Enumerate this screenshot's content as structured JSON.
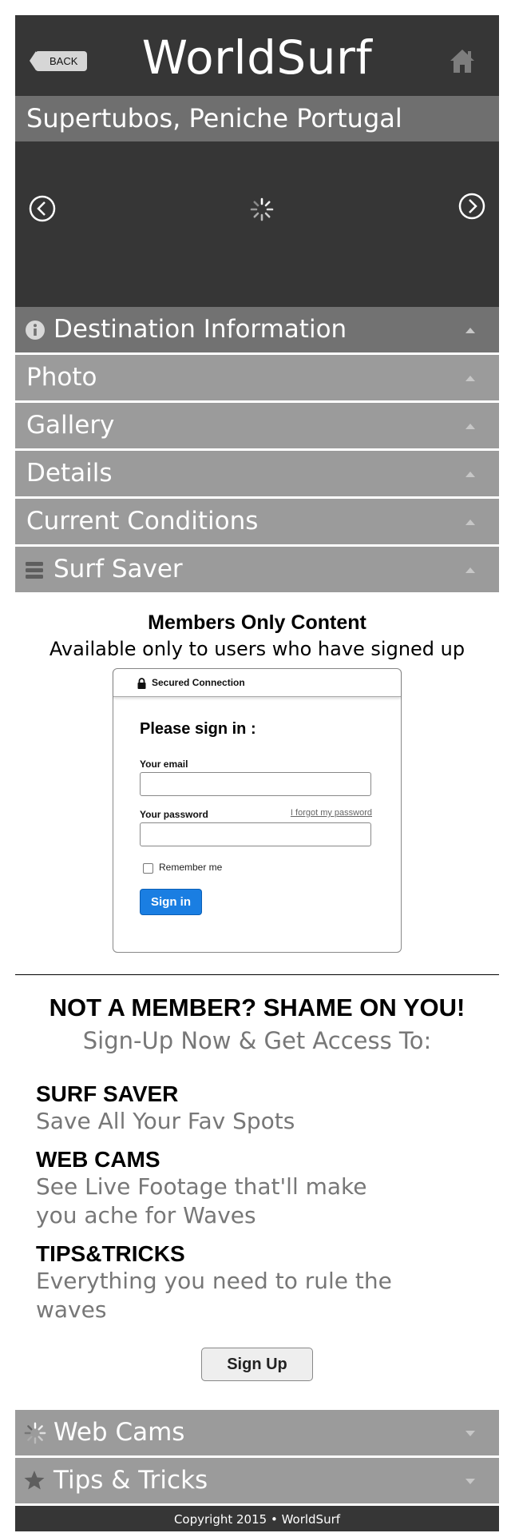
{
  "header": {
    "back_label": "BACK",
    "app_title": "WorldSurf",
    "home_icon": "home-icon"
  },
  "location": "Supertubos, Peniche Portugal",
  "slideshow": {
    "prev_icon": "chevron-left-icon",
    "next_icon": "chevron-right-icon",
    "loading_icon": "spinner-icon"
  },
  "accordion": [
    {
      "label": "Destination Information",
      "icon": "info-icon",
      "state": "expanded"
    },
    {
      "label": "Photo",
      "state": "expanded"
    },
    {
      "label": "Gallery",
      "state": "expanded"
    },
    {
      "label": "Details",
      "state": "expanded"
    },
    {
      "label": "Current Conditions",
      "state": "expanded"
    },
    {
      "label": "Surf Saver",
      "icon": "list-icon",
      "state": "expanded"
    }
  ],
  "members": {
    "title": "Members Only Content",
    "subtitle": "Available only to users who have signed up"
  },
  "login": {
    "secured_label": "Secured Connection",
    "heading": "Please sign in :",
    "email_label": "Your email",
    "email_value": "",
    "password_label": "Your password",
    "password_value": "",
    "forgot_link": "I forgot my password",
    "remember_label": "Remember me",
    "remember_checked": false,
    "submit_label": "Sign in"
  },
  "promo": {
    "title": "NOT A MEMBER? SHAME ON YOU!",
    "subtitle": "Sign-Up Now & Get Access To:",
    "features": [
      {
        "title": "SURF SAVER",
        "desc": "Save All Your Fav Spots"
      },
      {
        "title": "WEB CAMS",
        "desc": "See Live Footage that'll make you ache for Waves"
      },
      {
        "title": "TIPS&TRICKS",
        "desc": "Everything you need to rule the waves"
      }
    ],
    "signup_label": "Sign Up"
  },
  "bottom_accordion": [
    {
      "label": "Web Cams",
      "icon": "spinner-icon",
      "state": "collapsed"
    },
    {
      "label": "Tips & Tricks",
      "icon": "star-icon",
      "state": "collapsed"
    }
  ],
  "footer": "Copyright 2015 • WorldSurf",
  "colors": {
    "dark_bar": "#363636",
    "location_bar": "#6f6f6f",
    "accordion_row": "#9b9b9b",
    "signin_button": "#1a7ee2"
  }
}
